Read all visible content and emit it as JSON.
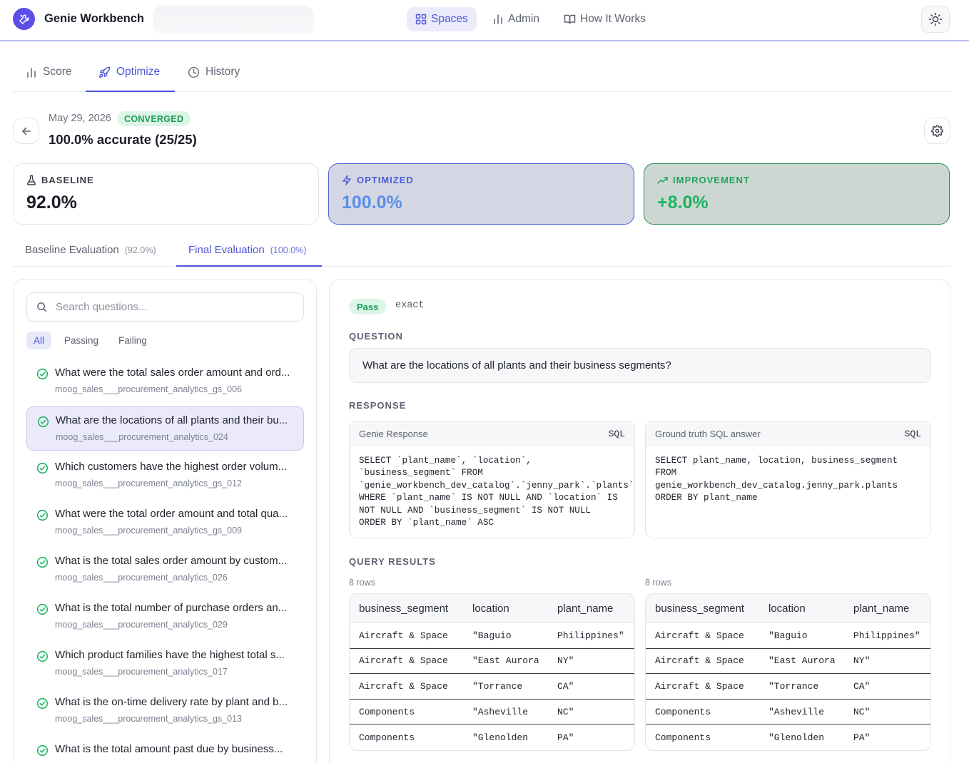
{
  "app": {
    "title": "Genie Workbench"
  },
  "nav": {
    "spaces": "Spaces",
    "admin": "Admin",
    "how_it_works": "How It Works"
  },
  "tabs": {
    "score": "Score",
    "optimize": "Optimize",
    "history": "History"
  },
  "run": {
    "date": "May 29, 2026",
    "status": "CONVERGED",
    "accuracy": "100.0% accurate (25/25)"
  },
  "cards": {
    "baseline": {
      "label": "BASELINE",
      "value": "92.0%"
    },
    "optimized": {
      "label": "OPTIMIZED",
      "value": "100.0%"
    },
    "improvement": {
      "label": "IMPROVEMENT",
      "value": "+8.0%"
    }
  },
  "eval_tabs": {
    "baseline": {
      "label": "Baseline Evaluation",
      "pct": "(92.0%)"
    },
    "final": {
      "label": "Final Evaluation",
      "pct": "(100.0%)"
    }
  },
  "search": {
    "placeholder": "Search questions..."
  },
  "filters": {
    "all": "All",
    "passing": "Passing",
    "failing": "Failing"
  },
  "questions": [
    {
      "text": "What were the total sales order amount and ord...",
      "id": "moog_sales___procurement_analytics_gs_006"
    },
    {
      "text": "What are the locations of all plants and their bu...",
      "id": "moog_sales___procurement_analytics_024"
    },
    {
      "text": "Which customers have the highest order volum...",
      "id": "moog_sales___procurement_analytics_gs_012"
    },
    {
      "text": "What were the total order amount and total qua...",
      "id": "moog_sales___procurement_analytics_gs_009"
    },
    {
      "text": "What is the total sales order amount by custom...",
      "id": "moog_sales___procurement_analytics_026"
    },
    {
      "text": "What is the total number of purchase orders an...",
      "id": "moog_sales___procurement_analytics_029"
    },
    {
      "text": "Which product families have the highest total s...",
      "id": "moog_sales___procurement_analytics_017"
    },
    {
      "text": "What is the on-time delivery rate by plant and b...",
      "id": "moog_sales___procurement_analytics_gs_013"
    },
    {
      "text": "What is the total amount past due by business...",
      "id": ""
    }
  ],
  "detail": {
    "pass_label": "Pass",
    "match_type": "exact",
    "question_label": "QUESTION",
    "question": "What are the locations of all plants and their business segments?",
    "response_label": "RESPONSE",
    "genie_title": "Genie Response",
    "genie_tag": "SQL",
    "genie_sql": "SELECT `plant_name`, `location`,\n`business_segment` FROM\n`genie_workbench_dev_catalog`.`jenny_park`.`plants`\nWHERE `plant_name` IS NOT NULL AND `location` IS\nNOT NULL AND `business_segment` IS NOT NULL\nORDER BY `plant_name` ASC",
    "truth_title": "Ground truth SQL answer",
    "truth_tag": "SQL",
    "truth_sql": "SELECT plant_name, location, business_segment\nFROM\ngenie_workbench_dev_catalog.jenny_park.plants\nORDER BY plant_name",
    "results_label": "QUERY RESULTS",
    "genie_rows": "8 rows",
    "truth_rows": "8 rows",
    "columns": [
      "business_segment",
      "location",
      "plant_name"
    ],
    "rows": [
      [
        "Aircraft & Space",
        "\"Baguio",
        "Philippines\""
      ],
      [
        "Aircraft & Space",
        "\"East Aurora",
        "NY\""
      ],
      [
        "Aircraft & Space",
        "\"Torrance",
        "CA\""
      ],
      [
        "Components",
        "\"Asheville",
        "NC\""
      ],
      [
        "Components",
        "\"Glenolden",
        "PA\""
      ]
    ]
  },
  "colors": {
    "accent": "#4c56d6",
    "brand": "#5b4ee6",
    "success": "#1d9a57"
  }
}
